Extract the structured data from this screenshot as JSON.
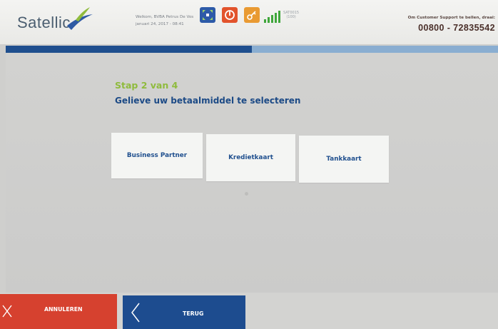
{
  "header": {
    "logo_text": "Satellic",
    "welcome_line": "Welkom, BVBA Petrus De Vos",
    "date_line": "januari 24, 2017 - 08:41",
    "device_id": "SAT0015",
    "signal_value": "(100)",
    "support_label": "Om Customer Support te bellen, draai:",
    "support_phone": "00800 - 72835542",
    "icons": [
      "network-icon",
      "power-icon",
      "key-icon",
      "signal-bars-icon"
    ]
  },
  "progress": {
    "current_step": 2,
    "total_steps": 4,
    "fraction": 0.5
  },
  "step": {
    "label": "Stap 2 van 4",
    "title": "Gelieve uw betaalmiddel te selecteren"
  },
  "options": [
    {
      "label": "Business Partner"
    },
    {
      "label": "Kredietkaart"
    },
    {
      "label": "Tankkaart"
    }
  ],
  "footer": {
    "cancel_label": "ANNULEREN",
    "back_label": "TERUG"
  },
  "colors": {
    "accent_green": "#8fbb3d",
    "primary_blue": "#1f4f8e",
    "cancel_red": "#d6412f",
    "progress_light": "#8aaed1"
  }
}
